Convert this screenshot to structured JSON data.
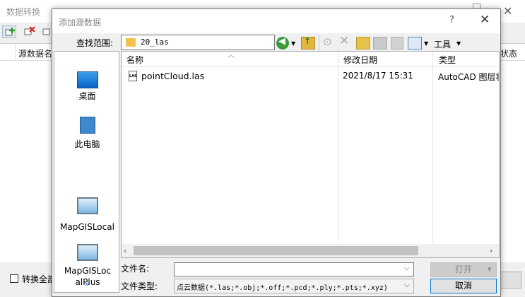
{
  "background_window": {
    "title": "数据转换",
    "table_col_source": "源数据名",
    "table_col_status": "状态",
    "convert_all_label": "转换全部"
  },
  "dialog": {
    "title": "添加源数据",
    "help": "?",
    "close": "✕",
    "lookin_label": "查找范围:",
    "lookin_value": "20_las",
    "tools_menu": "工具"
  },
  "places": [
    {
      "label": "桌面"
    },
    {
      "label": "此电脑"
    },
    {
      "label": "MapGISLocal"
    },
    {
      "label": "MapGISLocalPlus"
    }
  ],
  "places_more": "»",
  "file_list": {
    "columns": {
      "name": "名称",
      "date": "修改日期",
      "type": "类型"
    },
    "rows": [
      {
        "name": "pointCloud.las",
        "date": "2021/8/17 15:31",
        "type": "AutoCAD 图层状态"
      }
    ]
  },
  "filename_label": "文件名:",
  "filename_value": "",
  "filetype_label": "文件类型:",
  "filetype_value": "点云数据(*.las;*.obj;*.off;*.pcd;*.ply;*.pts;*.xyz)",
  "open_button": "打开",
  "cancel_button": "取消",
  "colors": {
    "accent": "#0078d7",
    "folder": "#f3c24c"
  }
}
